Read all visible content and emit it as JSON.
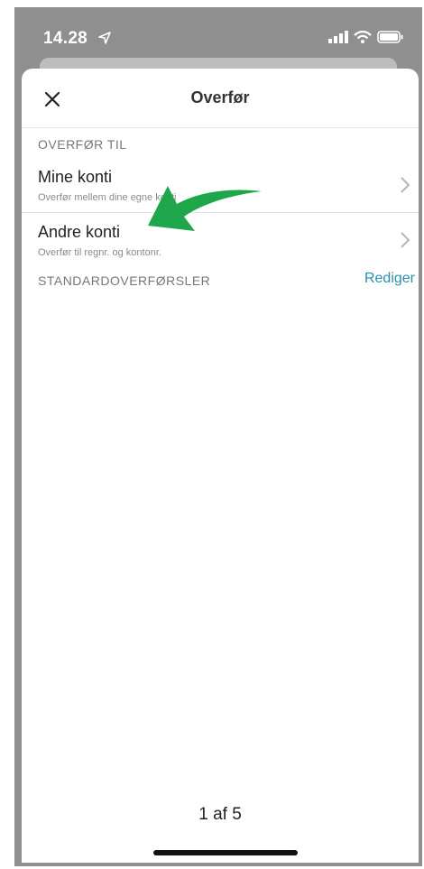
{
  "status_bar": {
    "time": "14.28",
    "icons": [
      "location-arrow-icon",
      "cellular-signal-icon",
      "wifi-icon",
      "battery-icon"
    ]
  },
  "header": {
    "title": "Overfør",
    "close_icon": "close-icon"
  },
  "sections": {
    "transfer_to": "OVERFØR TIL",
    "standard_transfers": "STANDARDOVERFØRSLER",
    "edit_label": "Rediger"
  },
  "rows": [
    {
      "title": "Mine konti",
      "subtitle": "Overfør mellem dine egne konti"
    },
    {
      "title": "Andre konti",
      "subtitle": "Overfør til regnr. og kontonr."
    }
  ],
  "footer": {
    "page_indicator": "1 af 5"
  },
  "annotation": {
    "arrow_color": "#1fa64a"
  },
  "colors": {
    "accent": "#2b8fa8",
    "frame_gray": "#8f8f8f"
  }
}
